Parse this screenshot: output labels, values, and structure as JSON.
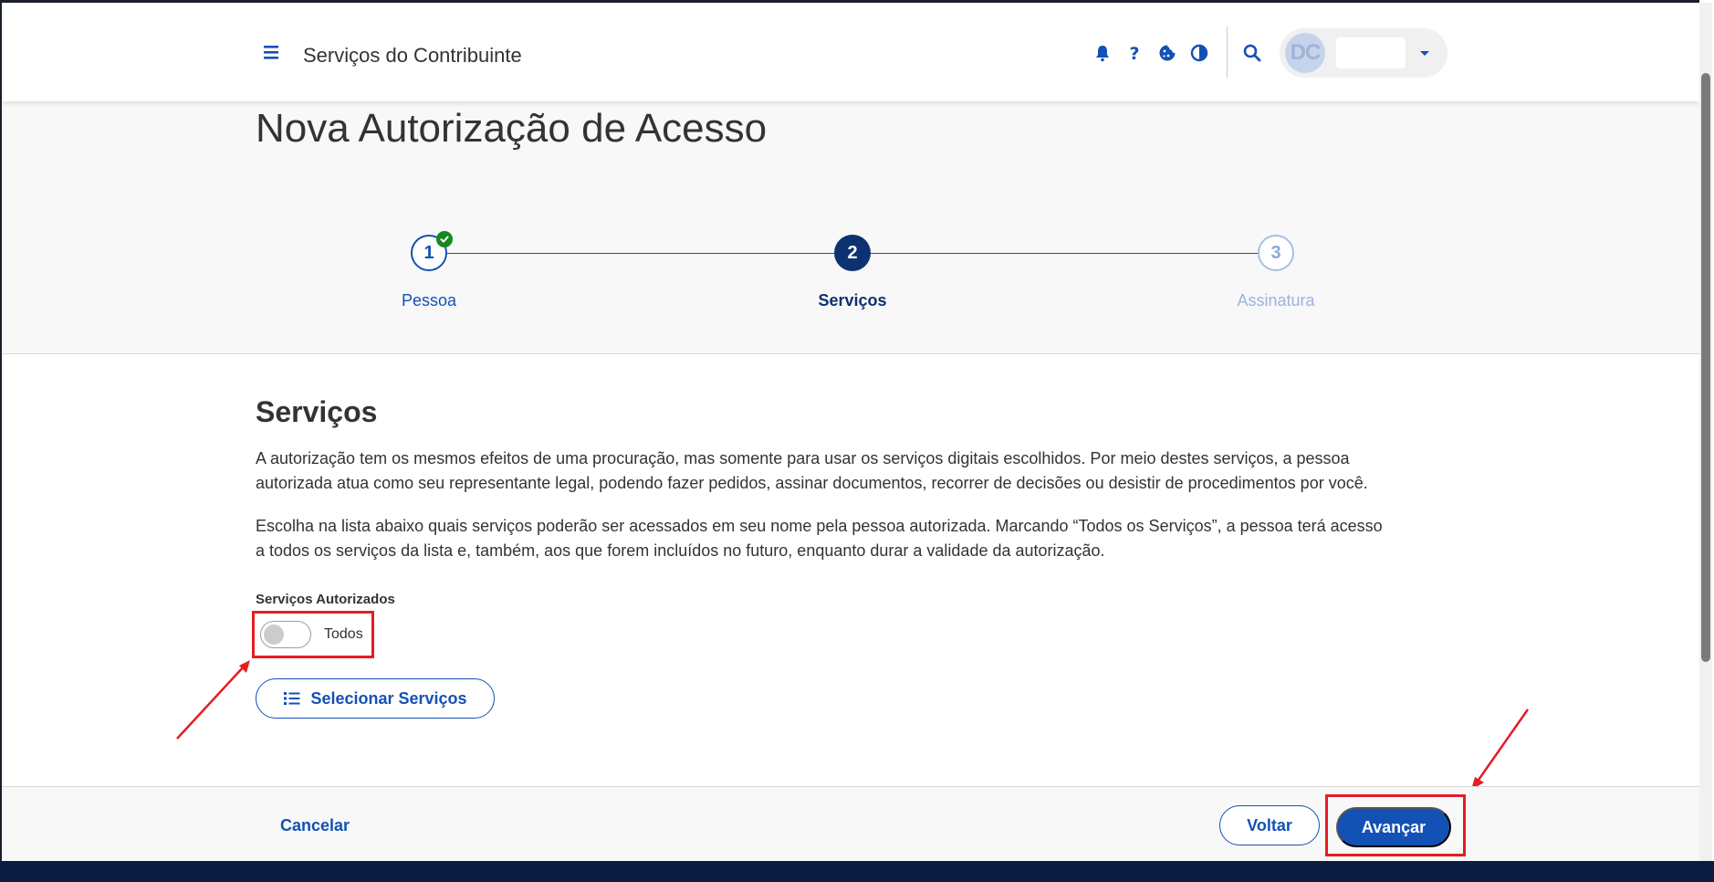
{
  "header": {
    "title": "Serviços do Contribuinte",
    "avatar_initials": "DC",
    "icons": [
      "menu-icon",
      "bell-icon",
      "help-icon",
      "cookie-icon",
      "contrast-icon",
      "search-icon",
      "caret-down-icon"
    ]
  },
  "page": {
    "title": "Nova Autorização de Acesso"
  },
  "stepper": {
    "steps": [
      {
        "number": "1",
        "label": "Pessoa",
        "state": "completed"
      },
      {
        "number": "2",
        "label": "Serviços",
        "state": "active"
      },
      {
        "number": "3",
        "label": "Assinatura",
        "state": "pending"
      }
    ]
  },
  "content": {
    "section_title": "Serviços",
    "paragraph1_line1": "A autorização tem os mesmos efeitos de uma procuração, mas somente para usar os serviços digitais escolhidos. Por meio destes serviços, a pessoa",
    "paragraph1_line2": "autorizada atua como seu representante legal, podendo fazer pedidos, assinar documentos, recorrer de decisões ou desistir de procedimentos por você.",
    "paragraph2_line1": "Escolha na lista abaixo quais serviços poderão ser acessados em seu nome pela pessoa autorizada. Marcando “Todos os Serviços”, a pessoa terá acesso",
    "paragraph2_line2": "a todos os serviços da lista e, também, aos que forem incluídos no futuro, enquanto durar a validade da autorização.",
    "field_label": "Serviços Autorizados",
    "toggle_label": "Todos",
    "toggle_on": false,
    "select_button": "Selecionar Serviços"
  },
  "footer": {
    "cancel": "Cancelar",
    "back": "Voltar",
    "next": "Avançar"
  },
  "colors": {
    "primary": "#1351b4",
    "active_step": "#0c326f",
    "success": "#168821",
    "annotation": "#e51c23"
  }
}
